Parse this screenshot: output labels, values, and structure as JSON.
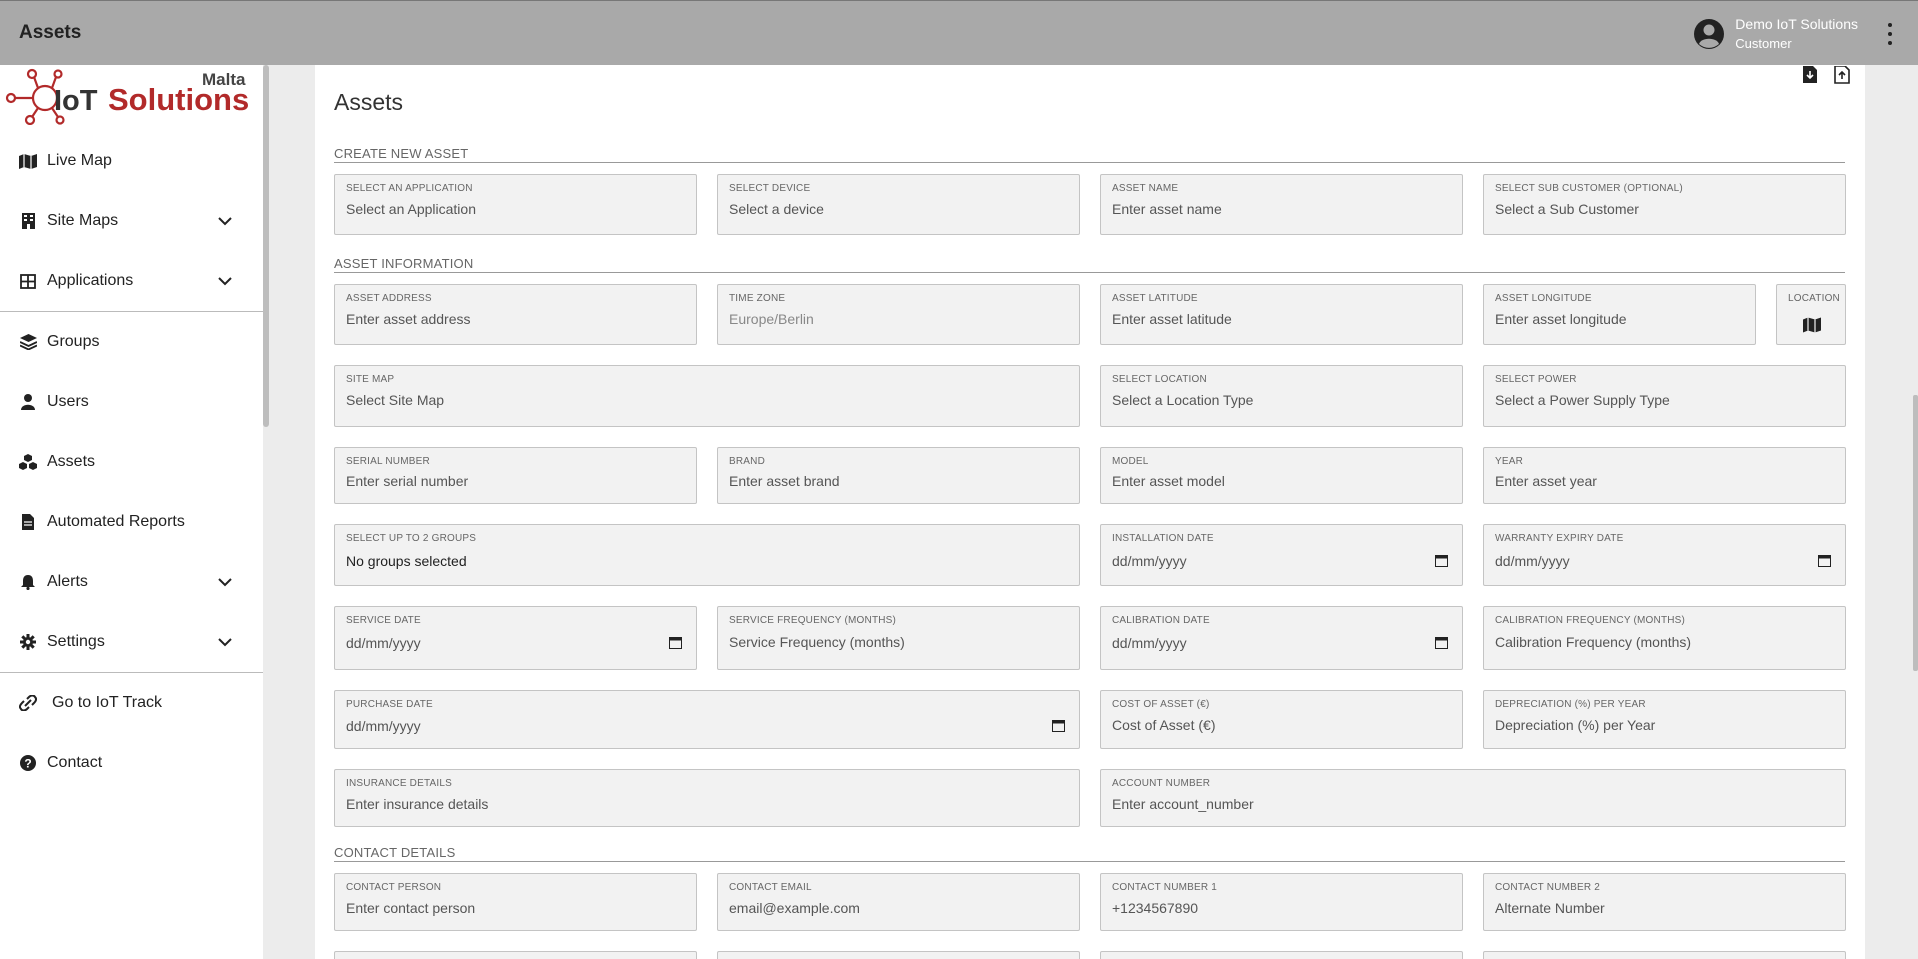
{
  "header": {
    "title": "Assets",
    "user_name": "Demo IoT Solutions",
    "user_role": "Customer"
  },
  "logo": {
    "text_brand": "Solutions",
    "text_prefix": "IoT",
    "text_region": "Malta",
    "brand_color": "#b22a2a"
  },
  "sidebar": {
    "items": [
      {
        "label": "Live Map",
        "icon": "map-icon"
      },
      {
        "label": "Site Maps",
        "icon": "building-icon"
      },
      {
        "label": "Applications",
        "icon": "grid-icon"
      },
      {
        "label": "Groups",
        "icon": "layers-icon"
      },
      {
        "label": "Users",
        "icon": "user-icon"
      },
      {
        "label": "Assets",
        "icon": "cubes-icon"
      },
      {
        "label": "Automated Reports",
        "icon": "file-icon"
      },
      {
        "label": "Alerts",
        "icon": "bell-icon"
      },
      {
        "label": "Settings",
        "icon": "gear-icon"
      },
      {
        "label": "Go to IoT Track",
        "icon": "link-icon"
      },
      {
        "label": "Contact",
        "icon": "help-icon"
      }
    ]
  },
  "main": {
    "title": "Assets",
    "sections": {
      "create": "CREATE NEW ASSET",
      "info": "ASSET INFORMATION",
      "contact": "CONTACT DETAILS"
    },
    "fields": {
      "application": {
        "label": "SELECT AN APPLICATION",
        "value": "Select an Application"
      },
      "device": {
        "label": "SELECT DEVICE",
        "value": "Select a device"
      },
      "asset_name": {
        "label": "ASSET NAME",
        "value": "Enter asset name"
      },
      "sub_customer": {
        "label": "SELECT SUB CUSTOMER (OPTIONAL)",
        "value": "Select a Sub Customer"
      },
      "address": {
        "label": "ASSET ADDRESS",
        "value": "Enter asset address"
      },
      "timezone": {
        "label": "TIME ZONE",
        "value": "Europe/Berlin"
      },
      "latitude": {
        "label": "ASSET LATITUDE",
        "value": "Enter asset latitude"
      },
      "longitude": {
        "label": "ASSET LONGITUDE",
        "value": "Enter asset longitude"
      },
      "location": {
        "label": "LOCATION"
      },
      "site_map": {
        "label": "SITE MAP",
        "value": "Select Site Map"
      },
      "location_type": {
        "label": "SELECT LOCATION",
        "value": "Select a Location Type"
      },
      "power": {
        "label": "SELECT POWER",
        "value": "Select a Power Supply Type"
      },
      "serial": {
        "label": "SERIAL NUMBER",
        "value": "Enter serial number"
      },
      "brand": {
        "label": "BRAND",
        "value": "Enter asset brand"
      },
      "model": {
        "label": "MODEL",
        "value": "Enter asset model"
      },
      "year": {
        "label": "YEAR",
        "value": "Enter asset year"
      },
      "groups": {
        "label": "SELECT UP TO 2 GROUPS",
        "value": "No groups selected"
      },
      "installation_date": {
        "label": "INSTALLATION DATE",
        "value": "dd/mm/yyyy"
      },
      "warranty_date": {
        "label": "WARRANTY EXPIRY DATE",
        "value": "dd/mm/yyyy"
      },
      "service_date": {
        "label": "SERVICE DATE",
        "value": "dd/mm/yyyy"
      },
      "service_freq": {
        "label": "SERVICE FREQUENCY (MONTHS)",
        "value": "Service Frequency (months)"
      },
      "calibration_date": {
        "label": "CALIBRATION DATE",
        "value": "dd/mm/yyyy"
      },
      "calibration_freq": {
        "label": "CALIBRATION FREQUENCY (MONTHS)",
        "value": "Calibration Frequency (months)"
      },
      "purchase_date": {
        "label": "PURCHASE DATE",
        "value": "dd/mm/yyyy"
      },
      "cost": {
        "label": "COST OF ASSET (€)",
        "value": "Cost of Asset (€)"
      },
      "depreciation": {
        "label": "DEPRECIATION (%) PER YEAR",
        "value": "Depreciation (%) per Year"
      },
      "insurance": {
        "label": "INSURANCE DETAILS",
        "value": "Enter insurance details"
      },
      "account": {
        "label": "ACCOUNT NUMBER",
        "value": "Enter account_number"
      },
      "contact_person": {
        "label": "CONTACT PERSON",
        "value": "Enter contact person"
      },
      "contact_email": {
        "label": "CONTACT EMAIL",
        "value": "email@example.com"
      },
      "contact_num1": {
        "label": "CONTACT NUMBER 1",
        "value": "+1234567890"
      },
      "contact_num2": {
        "label": "CONTACT NUMBER 2",
        "value": "Alternate Number"
      }
    }
  }
}
